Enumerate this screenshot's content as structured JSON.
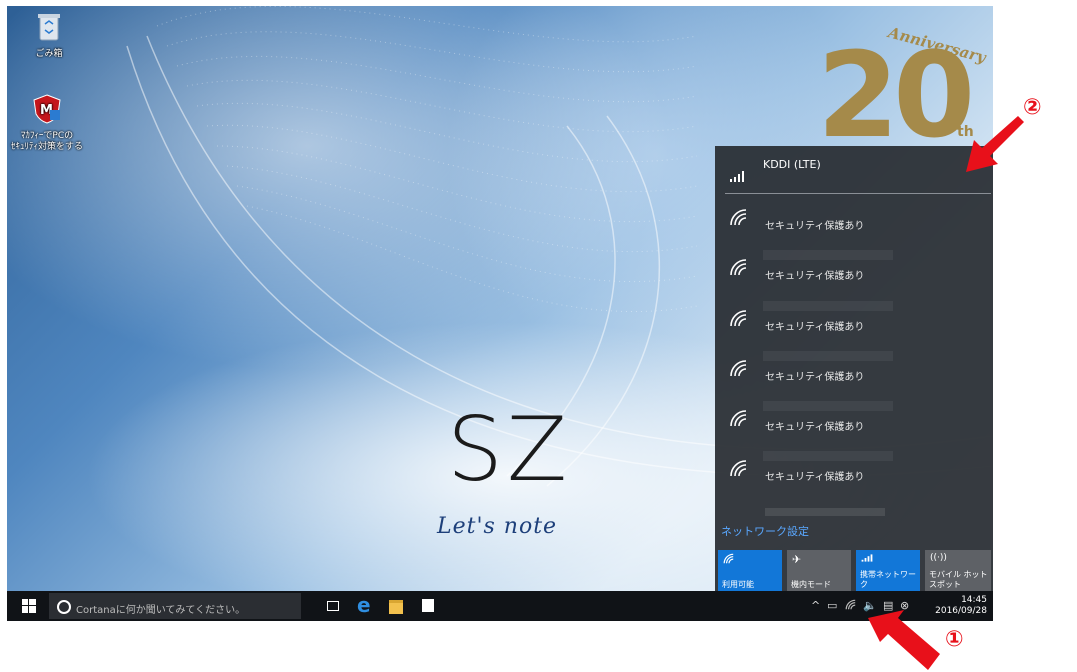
{
  "desktop": {
    "icons": [
      {
        "label": "ごみ箱",
        "icon": "recycle-bin-icon"
      },
      {
        "label": "ﾏｶﾌｨｰでPCの\nｾｷｭﾘﾃｨ対策をする",
        "icon": "mcafee-icon"
      }
    ],
    "branding": {
      "model": "SZ",
      "series": "Let's note",
      "anniversary_word": "Anniversary",
      "anniversary_number": "20",
      "anniversary_suffix": "th"
    }
  },
  "network_flyout": {
    "connected": {
      "name": "KDDI (LTE)",
      "icon": "cellular-signal-icon"
    },
    "wifi_networks": [
      {
        "status": "セキュリティ保護あり",
        "icon": "wifi-icon"
      },
      {
        "status": "セキュリティ保護あり",
        "icon": "wifi-icon"
      },
      {
        "status": "セキュリティ保護あり",
        "icon": "wifi-icon"
      },
      {
        "status": "セキュリティ保護あり",
        "icon": "wifi-icon"
      },
      {
        "status": "セキュリティ保護あり",
        "icon": "wifi-icon"
      },
      {
        "status": "セキュリティ保護あり",
        "icon": "wifi-icon"
      }
    ],
    "settings_link": "ネットワーク設定",
    "quick_actions": [
      {
        "label": "利用可能",
        "icon": "wifi-icon",
        "active": true
      },
      {
        "label": "機内モード",
        "icon": "airplane-icon",
        "active": false
      },
      {
        "label": "携帯ネットワーク",
        "icon": "cellular-signal-icon",
        "active": true
      },
      {
        "label": "モバイル ホットスポット",
        "icon": "hotspot-icon",
        "active": false
      }
    ]
  },
  "taskbar": {
    "search_placeholder": "Cortanaに何か聞いてみてください。",
    "pinned": [
      "task-view-icon",
      "edge-icon",
      "file-explorer-icon",
      "store-icon"
    ],
    "tray": {
      "time": "14:45",
      "date": "2016/09/28"
    }
  },
  "annotations": {
    "marker_1": "①",
    "marker_2": "②"
  },
  "colors": {
    "accent": "#1277d8",
    "flyout_bg": "#282c32",
    "taskbar_bg": "#101317",
    "callout": "#e8101a",
    "link": "#59a7ff"
  }
}
